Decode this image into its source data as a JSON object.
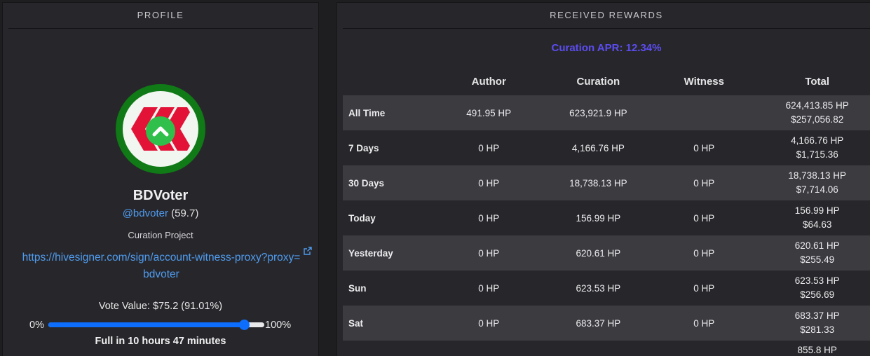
{
  "profile": {
    "panel_title": "PROFILE",
    "name": "BDVoter",
    "handle": "@bdvoter",
    "reputation": "(59.7)",
    "description": "Curation Project",
    "link": "https://hivesigner.com/sign/account-witness-proxy?proxy=bdvoter",
    "vote_value": "Vote Value: $75.2 (91.01%)",
    "slider_min": "0%",
    "slider_max": "100%",
    "slider_percent": 91.01,
    "full_in": "Full in 10 hours 47 minutes",
    "icons": [
      "hive-logo-icon",
      "upvote-icon",
      "external-link-icon"
    ],
    "avatar_ring_color": "#0f7a16"
  },
  "rewards": {
    "panel_title": "RECEIVED REWARDS",
    "apr": "Curation APR: 12.34%",
    "columns": [
      "",
      "Author",
      "Curation",
      "Witness",
      "Total"
    ],
    "rows": [
      {
        "label": "All Time",
        "author": "491.95 HP",
        "curation": "623,921.9 HP",
        "witness": "",
        "total_hp": "624,413.85 HP",
        "total_usd": "$257,056.82"
      },
      {
        "label": "7 Days",
        "author": "0 HP",
        "curation": "4,166.76 HP",
        "witness": "0 HP",
        "total_hp": "4,166.76 HP",
        "total_usd": "$1,715.36"
      },
      {
        "label": "30 Days",
        "author": "0 HP",
        "curation": "18,738.13 HP",
        "witness": "0 HP",
        "total_hp": "18,738.13 HP",
        "total_usd": "$7,714.06"
      },
      {
        "label": "Today",
        "author": "0 HP",
        "curation": "156.99 HP",
        "witness": "0 HP",
        "total_hp": "156.99 HP",
        "total_usd": "$64.63"
      },
      {
        "label": "Yesterday",
        "author": "0 HP",
        "curation": "620.61 HP",
        "witness": "0 HP",
        "total_hp": "620.61 HP",
        "total_usd": "$255.49"
      },
      {
        "label": "Sun",
        "author": "0 HP",
        "curation": "623.53 HP",
        "witness": "0 HP",
        "total_hp": "623.53 HP",
        "total_usd": "$256.69"
      },
      {
        "label": "Sat",
        "author": "0 HP",
        "curation": "683.37 HP",
        "witness": "0 HP",
        "total_hp": "683.37 HP",
        "total_usd": "$281.33"
      },
      {
        "label": "",
        "author": "",
        "curation": "",
        "witness": "",
        "total_hp": "855.8 HP",
        "total_usd": ""
      }
    ],
    "accent_color": "#5b4cf0"
  }
}
